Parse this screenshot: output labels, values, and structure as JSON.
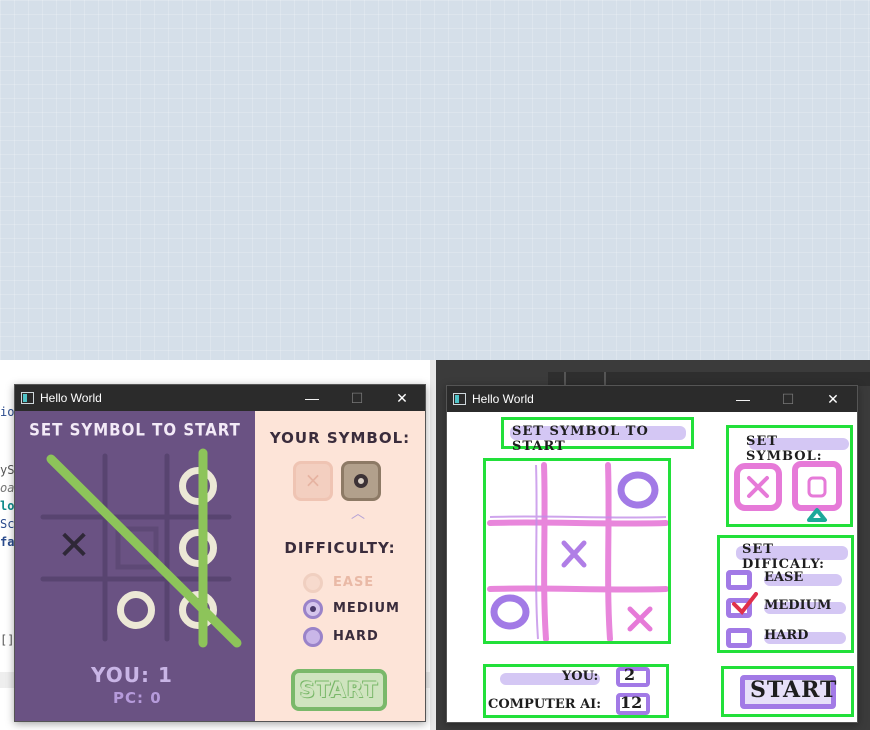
{
  "ide": {
    "fragments": [
      "io",
      "yS",
      "oa",
      "lo",
      "Sc",
      "fa",
      "[]"
    ]
  },
  "left_window": {
    "title": "Hello World",
    "controls": {
      "minimize": "—",
      "maximize": "☐",
      "close": "✕"
    },
    "heading": "SET SYMBOL TO START",
    "board": [
      "",
      "",
      "O",
      "X",
      "",
      "O",
      "",
      "O",
      "O"
    ],
    "win_line": "diagonal",
    "your_symbol_label": "YOUR SYMBOL:",
    "symbols": [
      "×",
      "O"
    ],
    "selected_symbol": "O",
    "difficulty_label": "DIFFICULTY:",
    "difficulties": [
      "EASE",
      "MEDIUM",
      "HARD"
    ],
    "selected_difficulty": "MEDIUM",
    "start_label": "START",
    "score_you": "YOU: 1",
    "score_pc": "PC: 0",
    "colors": {
      "board_bg": "#6a5283",
      "side_bg": "#fde4d8",
      "win_line": "#8dc45a",
      "o_color": "#ece8d6",
      "x_color": "#2f2838"
    }
  },
  "right_window": {
    "title": "Hello World",
    "controls": {
      "minimize": "—",
      "maximize": "☐",
      "close": "✕"
    },
    "heading": "SET SYMBOL TO START",
    "set_symbol_label": "SET SYMBOL:",
    "set_difficulty_label": "SET DIFICALY:",
    "difficulties": [
      "EASE",
      "MEDIUM",
      "HARD"
    ],
    "you_label": "YOU:",
    "you_score": "2",
    "computer_label": "COMPUTER AI:",
    "computer_score": "12",
    "start_label": "START",
    "colors": {
      "box": "#22e03a",
      "sketch": "#e67ad8",
      "highlight": "#a082e6"
    }
  }
}
